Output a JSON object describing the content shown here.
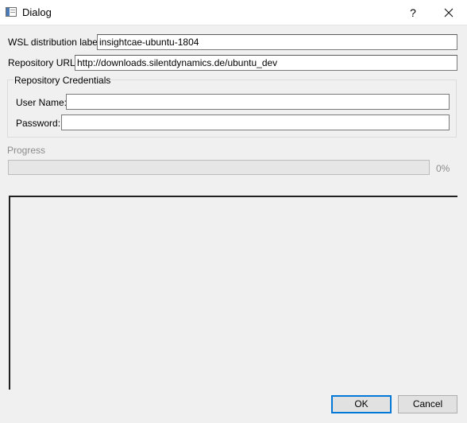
{
  "window": {
    "title": "Dialog",
    "help_glyph": "?",
    "icons": {
      "app": "dialog-window-icon",
      "close": "close-icon"
    }
  },
  "form": {
    "wsl_label": "WSL distribution label:",
    "wsl_value": "insightcae-ubuntu-1804",
    "repo_url_label": "Repository URL:",
    "repo_url_value": "http://downloads.silentdynamics.de/ubuntu_dev"
  },
  "credentials": {
    "title": "Repository Credentials",
    "user_label": "User Name:",
    "user_value": "",
    "password_label": "Password:",
    "password_value": ""
  },
  "progress": {
    "label": "Progress",
    "percent_text": "0%",
    "value_fraction": 0
  },
  "log": {
    "text": ""
  },
  "buttons": {
    "ok": "OK",
    "cancel": "Cancel"
  },
  "colors": {
    "ok_focus_border": "#0078d7",
    "progress_fill": "#06b025"
  }
}
